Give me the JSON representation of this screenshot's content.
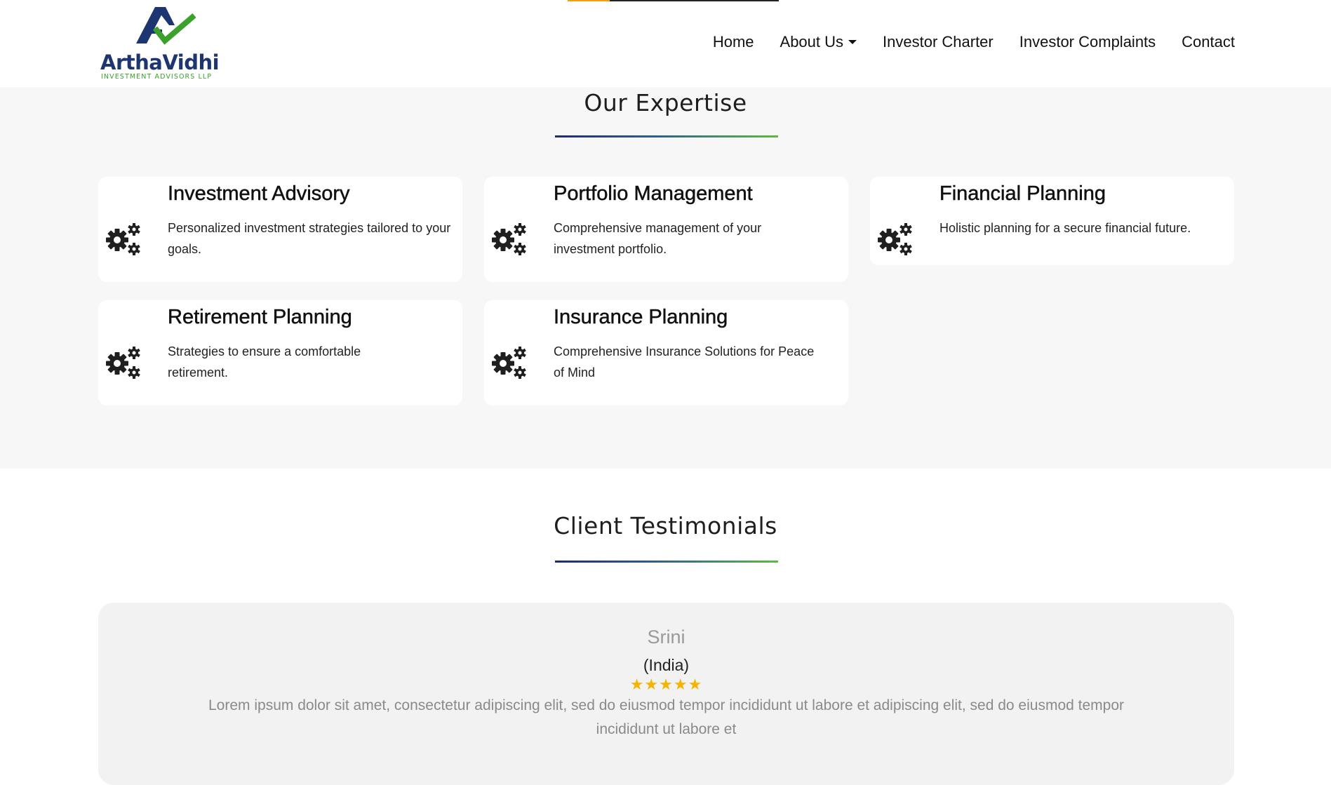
{
  "brand": {
    "name": "ArthaVidhi",
    "tagline": "INVESTMENT ADVISORS LLP",
    "logo_icon": "arrow-check-logo",
    "colors": {
      "navy": "#1d3571",
      "green": "#3aa12b"
    }
  },
  "nav": {
    "items": [
      {
        "label": "Home"
      },
      {
        "label": "About Us",
        "has_dropdown": true
      },
      {
        "label": "Investor Charter"
      },
      {
        "label": "Investor Complaints"
      },
      {
        "label": "Contact"
      }
    ]
  },
  "expertise": {
    "title": "Our Expertise",
    "cards": [
      {
        "title": "Investment Advisory",
        "desc": "Personalized investment strategies tailored to your goals.",
        "icon": "gears-icon"
      },
      {
        "title": "Portfolio Management",
        "desc": "Comprehensive management of your investment portfolio.",
        "icon": "gears-icon"
      },
      {
        "title": "Financial Planning",
        "desc": "Holistic planning for a secure financial future.",
        "icon": "gears-icon"
      },
      {
        "title": "Retirement Planning",
        "desc": "Strategies to ensure a comfortable retirement.",
        "icon": "gears-icon"
      },
      {
        "title": "Insurance Planning",
        "desc": "Comprehensive Insurance Solutions for Peace of Mind",
        "icon": "gears-icon"
      }
    ]
  },
  "testimonials": {
    "title": "Client Testimonials",
    "items": [
      {
        "name": "Srini",
        "country": "(India)",
        "rating": 5,
        "stars": "★★★★★",
        "text": "Lorem ipsum dolor sit amet, consectetur adipiscing elit, sed do eiusmod tempor incididunt ut labore et adipiscing elit, sed do eiusmod tempor incididunt ut labore et"
      }
    ]
  },
  "colors": {
    "accent_gradient_start": "#1d2a78",
    "accent_gradient_end": "#5dbb3e",
    "section_bg": "#f7f7f7",
    "star": "#f5b400"
  }
}
